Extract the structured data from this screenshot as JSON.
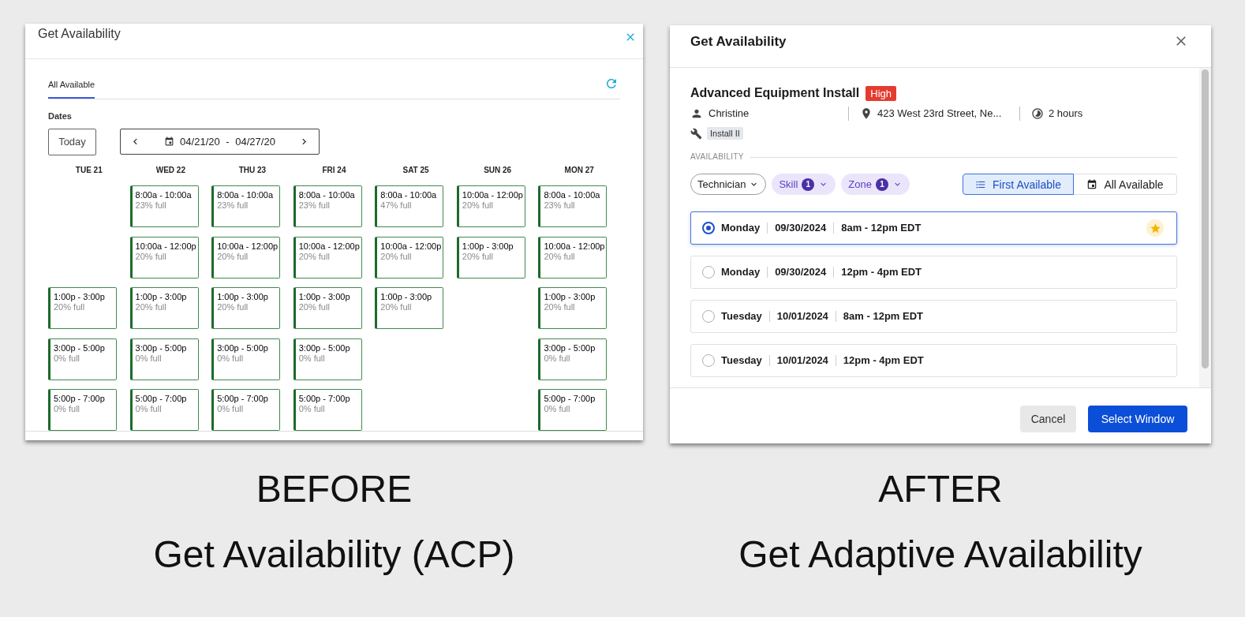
{
  "before": {
    "dialog": {
      "title": "Get Availability",
      "tabs": [
        {
          "label": "All Available",
          "selected": true
        }
      ],
      "dates_label": "Dates",
      "today_button": "Today",
      "date_range": "04/21/20 - 04/27/20",
      "days": [
        {
          "label": "TUE 21",
          "slots": [
            {
              "kind": "empty"
            },
            {
              "kind": "empty"
            },
            {
              "kind": "slot",
              "time": "1:00p - 3:00p",
              "fill": "20% full"
            },
            {
              "kind": "slot",
              "time": "3:00p - 5:00p",
              "fill": "0% full"
            },
            {
              "kind": "slot",
              "time": "5:00p - 7:00p",
              "fill": "0% full"
            }
          ]
        },
        {
          "label": "WED 22",
          "slots": [
            {
              "kind": "slot",
              "time": "8:00a - 10:00a",
              "fill": "23% full"
            },
            {
              "kind": "slot",
              "time": "10:00a - 12:00p",
              "fill": "20% full"
            },
            {
              "kind": "slot",
              "time": "1:00p - 3:00p",
              "fill": "20% full"
            },
            {
              "kind": "slot",
              "time": "3:00p - 5:00p",
              "fill": "0% full"
            },
            {
              "kind": "slot",
              "time": "5:00p - 7:00p",
              "fill": "0% full"
            }
          ]
        },
        {
          "label": "THU 23",
          "slots": [
            {
              "kind": "slot",
              "time": "8:00a - 10:00a",
              "fill": "23% full"
            },
            {
              "kind": "slot",
              "time": "10:00a - 12:00p",
              "fill": "20% full"
            },
            {
              "kind": "slot",
              "time": "1:00p - 3:00p",
              "fill": "20% full"
            },
            {
              "kind": "slot",
              "time": "3:00p - 5:00p",
              "fill": "0% full"
            },
            {
              "kind": "slot",
              "time": "5:00p - 7:00p",
              "fill": "0% full"
            }
          ]
        },
        {
          "label": "FRI 24",
          "slots": [
            {
              "kind": "slot",
              "time": "8:00a - 10:00a",
              "fill": "23% full"
            },
            {
              "kind": "slot",
              "time": "10:00a - 12:00p",
              "fill": "20% full"
            },
            {
              "kind": "slot",
              "time": "1:00p - 3:00p",
              "fill": "20% full"
            },
            {
              "kind": "slot",
              "time": "3:00p - 5:00p",
              "fill": "0% full"
            },
            {
              "kind": "slot",
              "time": "5:00p - 7:00p",
              "fill": "0% full"
            }
          ]
        },
        {
          "label": "SAT 25",
          "slots": [
            {
              "kind": "slot",
              "time": "8:00a - 10:00a",
              "fill": "47% full"
            },
            {
              "kind": "slot",
              "time": "10:00a - 12:00p",
              "fill": "20% full"
            },
            {
              "kind": "slot",
              "time": "1:00p - 3:00p",
              "fill": "20% full"
            }
          ]
        },
        {
          "label": "SUN 26",
          "slots": [
            {
              "kind": "slot",
              "time": "10:00a - 12:00p",
              "fill": "20% full"
            },
            {
              "kind": "slot",
              "time": "1:00p - 3:00p",
              "fill": "20% full"
            }
          ]
        },
        {
          "label": "MON 27",
          "slots": [
            {
              "kind": "slot",
              "time": "8:00a - 10:00a",
              "fill": "23% full"
            },
            {
              "kind": "slot",
              "time": "10:00a - 12:00p",
              "fill": "20% full"
            },
            {
              "kind": "slot",
              "time": "1:00p - 3:00p",
              "fill": "20% full"
            },
            {
              "kind": "slot",
              "time": "3:00p - 5:00p",
              "fill": "0% full"
            },
            {
              "kind": "slot",
              "time": "5:00p - 7:00p",
              "fill": "0% full"
            }
          ]
        }
      ]
    },
    "caption": "BEFORE",
    "subtitle": "Get Availability (ACP)"
  },
  "after": {
    "dialog": {
      "title": "Get Availability",
      "job": {
        "name": "Advanced Equipment Install",
        "priority": "High",
        "technician": "Christine",
        "address": "423 West 23rd Street, Ne...",
        "duration": "2 hours",
        "skill_tag": "Install II"
      },
      "section_label": "AVAILABILITY",
      "filters": [
        {
          "kind": "plain",
          "label": "Technician"
        },
        {
          "kind": "count",
          "label": "Skill",
          "count": "1"
        },
        {
          "kind": "count",
          "label": "Zone",
          "count": "1"
        }
      ],
      "view_toggle": [
        {
          "kind": "list",
          "label": "First Available",
          "selected": true
        },
        {
          "kind": "calendar",
          "label": "All Available",
          "selected": false
        }
      ],
      "windows": [
        {
          "day": "Monday",
          "date": "09/30/2024",
          "time": "8am - 12pm EDT",
          "selected": true,
          "recommended": true
        },
        {
          "day": "Monday",
          "date": "09/30/2024",
          "time": "12pm - 4pm EDT",
          "selected": false,
          "recommended": false
        },
        {
          "day": "Tuesday",
          "date": "10/01/2024",
          "time": "8am - 12pm EDT",
          "selected": false,
          "recommended": false
        },
        {
          "day": "Tuesday",
          "date": "10/01/2024",
          "time": "12pm - 4pm EDT",
          "selected": false,
          "recommended": false
        }
      ],
      "buttons": {
        "cancel": "Cancel",
        "confirm": "Select Window"
      }
    },
    "caption": "AFTER",
    "subtitle": "Get Adaptive Availability"
  }
}
